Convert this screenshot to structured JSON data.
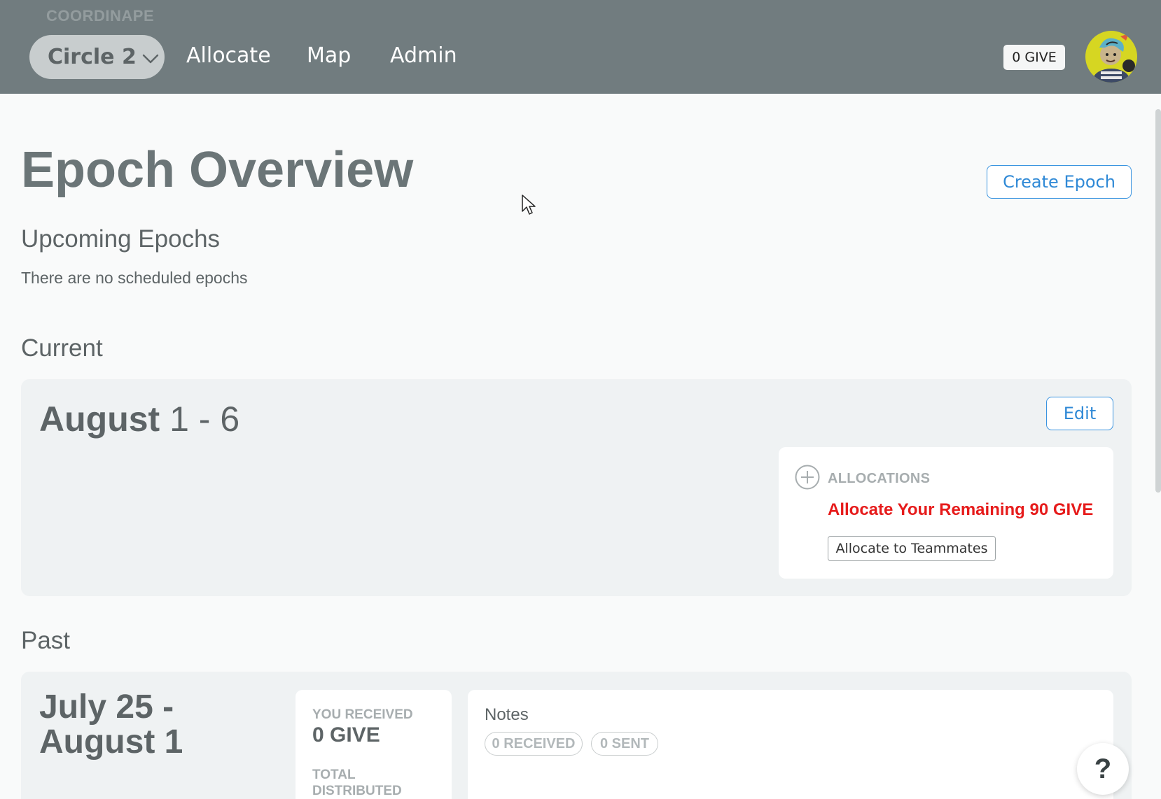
{
  "header": {
    "logo": "COORDINAPE",
    "circle_selector": "Circle 2",
    "nav": [
      "Allocate",
      "Map",
      "Admin"
    ],
    "give_badge": "0 GIVE"
  },
  "main": {
    "title": "Epoch Overview",
    "create_epoch_label": "Create Epoch",
    "upcoming": {
      "heading": "Upcoming Epochs",
      "empty_message": "There are no scheduled epochs"
    },
    "current": {
      "heading": "Current",
      "epoch_month": "August",
      "epoch_days": "1 - 6",
      "edit_label": "Edit",
      "allocations": {
        "label": "ALLOCATIONS",
        "warning": "Allocate Your Remaining 90 GIVE",
        "button_label": "Allocate to Teammates"
      }
    },
    "past": {
      "heading": "Past",
      "epoch_title_line1": "July 25 -",
      "epoch_title_line2": "August 1",
      "you_received_label": "YOU RECEIVED",
      "you_received_value": "0 GIVE",
      "total_distributed_line1": "TOTAL",
      "total_distributed_line2": "DISTRIBUTED",
      "notes_label": "Notes",
      "chip_received": "0 RECEIVED",
      "chip_sent": "0 SENT"
    }
  },
  "help_label": "?",
  "colors": {
    "header_bg": "#717c7f",
    "accent_blue": "#2f89d6",
    "warning_red": "#e61b1b",
    "card_bg": "#eff2f3"
  }
}
